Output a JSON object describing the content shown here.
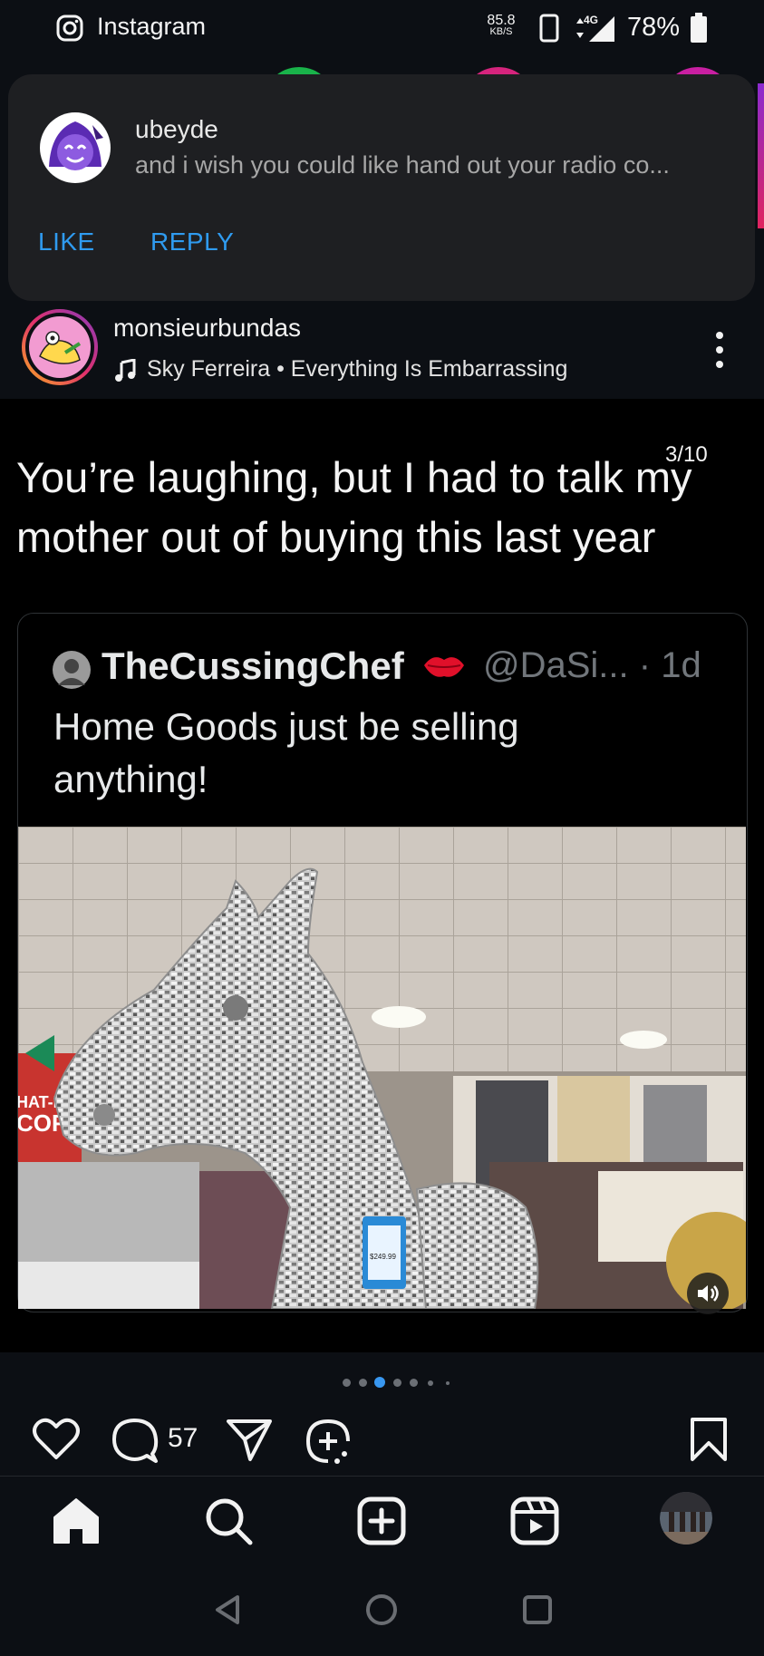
{
  "status_bar": {
    "app_name": "Instagram",
    "net_speed_value": "85.8",
    "net_speed_unit": "KB/S",
    "network": "4G",
    "battery": "78%"
  },
  "notification": {
    "username": "ubeyde",
    "message": "and i wish you could like hand out your radio co...",
    "like_label": "LIKE",
    "reply_label": "REPLY"
  },
  "post": {
    "username": "monsieurbundas",
    "music": "Sky Ferreira • Everything Is Embarrassing",
    "caption_line1": "You’re laughing, but I had to talk my",
    "caption_line2": "mother out of buying this last year",
    "counter": "3/10",
    "comment_count": "57"
  },
  "tweet": {
    "display_name": "TheCussingChef",
    "handle_time": "@DaSi... · 1d",
    "text_line1": "Home Goods just be selling",
    "text_line2": "anything!",
    "price_tag": "$249.99",
    "sign_text_1": "HAT-FUN",
    "sign_text_2": "COR"
  },
  "colors": {
    "background": "#0c0f14",
    "notification_bg": "#1e1f22",
    "action_blue": "#2f9bf0",
    "active_dot": "#3897f0"
  },
  "icons": {
    "nav": [
      "home-icon",
      "search-icon",
      "create-icon",
      "reels-icon",
      "profile-avatar"
    ],
    "actions": [
      "heart-icon",
      "comment-icon",
      "share-icon",
      "remix-icon",
      "bookmark-icon"
    ]
  }
}
